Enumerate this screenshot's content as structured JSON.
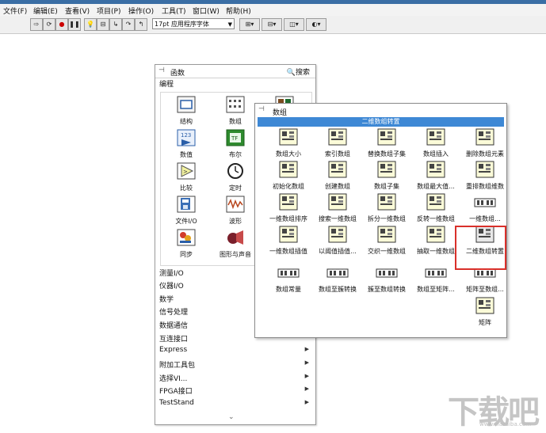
{
  "menu": [
    "文件(F)",
    "编辑(E)",
    "查看(V)",
    "项目(P)",
    "操作(O)",
    "工具(T)",
    "窗口(W)",
    "帮助(H)"
  ],
  "toolbar": {
    "font_select": "17pt 应用程序字体"
  },
  "functions_palette": {
    "title": "函数",
    "search_label": "搜索",
    "category": "编程",
    "grid": [
      {
        "label": "结构",
        "icon": "structures-icon"
      },
      {
        "label": "数组",
        "icon": "array-icon"
      },
      {
        "label": "簇",
        "icon": "cluster-icon"
      },
      {
        "label": "数值",
        "icon": "numeric-icon"
      },
      {
        "label": "布尔",
        "icon": "boolean-icon"
      },
      {
        "label": "",
        "icon": ""
      },
      {
        "label": "比较",
        "icon": "comparison-icon"
      },
      {
        "label": "定时",
        "icon": "timing-icon"
      },
      {
        "label": "",
        "icon": ""
      },
      {
        "label": "文件I/O",
        "icon": "file-io-icon"
      },
      {
        "label": "波形",
        "icon": "waveform-icon"
      },
      {
        "label": "",
        "icon": ""
      },
      {
        "label": "同步",
        "icon": "synchronization-icon"
      },
      {
        "label": "图形与声音",
        "icon": "graphics-sound-icon"
      }
    ],
    "subpalettes": [
      "测量I/O",
      "仪器I/O",
      "数学",
      "信号处理",
      "数据通信",
      "互连接口",
      "Express",
      "附加工具包",
      "选择VI...",
      "FPGA接口",
      "TestStand"
    ]
  },
  "array_palette": {
    "title": "数组",
    "tooltip": "二维数组转置",
    "items": [
      {
        "label": "数组大小",
        "icon": "array-size-icon"
      },
      {
        "label": "索引数组",
        "icon": "index-array-icon"
      },
      {
        "label": "替换数组子集",
        "icon": "replace-subset-icon"
      },
      {
        "label": "数组插入",
        "icon": "insert-into-array-icon"
      },
      {
        "label": "删除数组元素",
        "icon": "delete-from-array-icon"
      },
      {
        "label": "初始化数组",
        "icon": "initialize-array-icon"
      },
      {
        "label": "创建数组",
        "icon": "build-array-icon"
      },
      {
        "label": "数组子集",
        "icon": "array-subset-icon"
      },
      {
        "label": "数组最大值...",
        "icon": "array-max-min-icon"
      },
      {
        "label": "重排数组维数",
        "icon": "reshape-array-icon"
      },
      {
        "label": "一维数组排序",
        "icon": "sort-1d-array-icon"
      },
      {
        "label": "搜索一维数组",
        "icon": "search-1d-array-icon"
      },
      {
        "label": "拆分一维数组",
        "icon": "split-1d-array-icon"
      },
      {
        "label": "反转一维数组",
        "icon": "reverse-1d-array-icon"
      },
      {
        "label": "一维数组...",
        "icon": "rotate-1d-array-icon"
      },
      {
        "label": "一维数组插值",
        "icon": "interpolate-1d-array-icon"
      },
      {
        "label": "以阈值插值...",
        "icon": "threshold-1d-array-icon"
      },
      {
        "label": "交织一维数组",
        "icon": "interleave-1d-arrays-icon"
      },
      {
        "label": "抽取一维数组",
        "icon": "decimate-1d-array-icon"
      },
      {
        "label": "二维数组转置",
        "icon": "transpose-2d-array-icon"
      },
      {
        "label": "数组常量",
        "icon": "array-constant-icon"
      },
      {
        "label": "数组至簇转换",
        "icon": "array-to-cluster-icon"
      },
      {
        "label": "簇至数组转换",
        "icon": "cluster-to-array-icon"
      },
      {
        "label": "数组至矩阵...",
        "icon": "array-to-matrix-icon"
      },
      {
        "label": "矩阵至数组...",
        "icon": "matrix-to-array-icon"
      },
      {
        "label": "矩阵",
        "icon": "matrix-icon"
      }
    ]
  },
  "watermark": {
    "text": "下载吧",
    "url": "www.xiazaiba.com"
  }
}
